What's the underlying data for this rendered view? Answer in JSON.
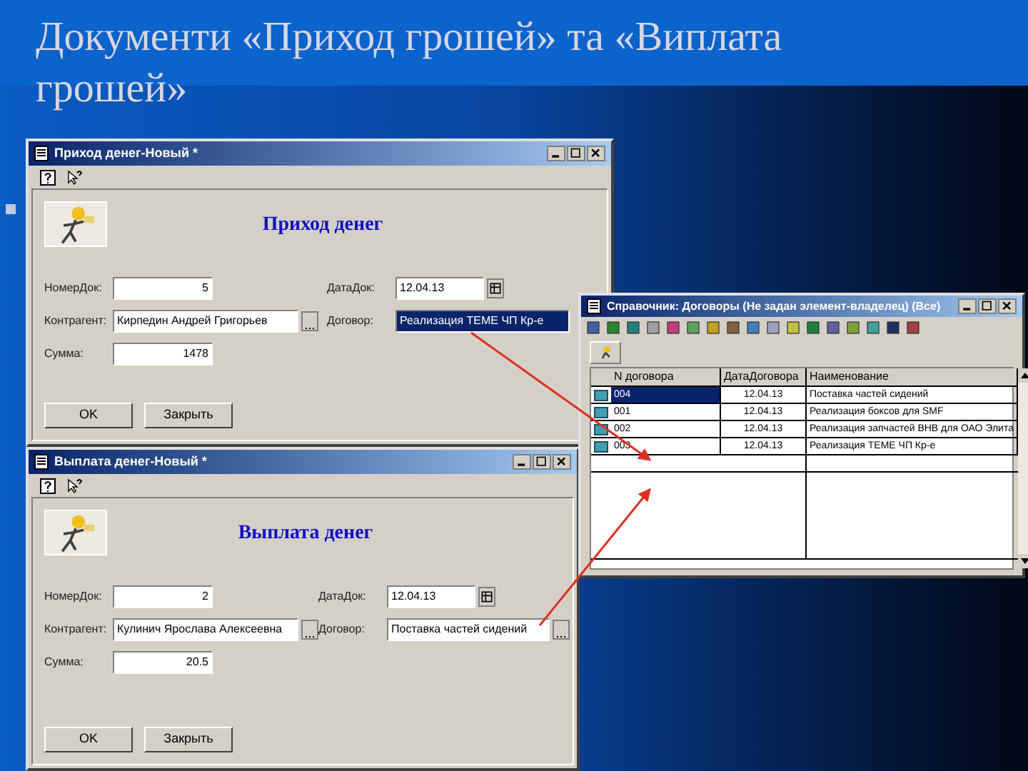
{
  "slide_title": "Документи «Приход грошей» та «Виплата грошей»",
  "windows": [
    {
      "title": "Приход денег-Новый *",
      "heading": "Приход денег",
      "left_fields": [
        {
          "label": "НомерДок:",
          "value": "5",
          "kind": "number"
        },
        {
          "label": "Контрагент:",
          "value": "Кирпедин Андрей Григорьев",
          "kind": "select"
        },
        {
          "label": "Сумма:",
          "value": "1478",
          "kind": "number"
        }
      ],
      "right_fields": [
        {
          "label": "ДатаДок:",
          "value": "12.04.13",
          "kind": "date",
          "highlighted": false
        },
        {
          "label": "Договор:",
          "value": "Реализация ТЕМЕ ЧП Кр-е",
          "kind": "text",
          "highlighted": true
        }
      ],
      "buttons": [
        "OK",
        "Закрыть"
      ]
    },
    {
      "title": "Выплата денег-Новый *",
      "heading": "Выплата денег",
      "left_fields": [
        {
          "label": "НомерДок:",
          "value": "2",
          "kind": "number"
        },
        {
          "label": "Контрагент:",
          "value": "Кулинич Ярослава Алексеевна",
          "kind": "select"
        },
        {
          "label": "Сумма:",
          "value": "20.5",
          "kind": "number"
        }
      ],
      "right_fields": [
        {
          "label": "ДатаДок:",
          "value": "12.04.13",
          "kind": "date",
          "highlighted": false
        },
        {
          "label": "Договор:",
          "value": "Поставка частей сидений",
          "kind": "select",
          "highlighted": false
        }
      ],
      "buttons": [
        "OK",
        "Закрыть"
      ]
    }
  ],
  "catalog": {
    "title": "Справочник: Договоры (Не задан элемент-владелец) (Все)",
    "columns": [
      "N договора",
      "ДатаДоговора",
      "Наименование"
    ],
    "rows": [
      {
        "cells": [
          "004",
          "12.04.13",
          "Поставка частей сидений"
        ],
        "selected": true
      },
      {
        "cells": [
          "001",
          "12.04.13",
          "Реализация боксов для SMF"
        ],
        "selected": false
      },
      {
        "cells": [
          "002",
          "12.04.13",
          "Реализация запчастей ВНВ для ОАО Элита"
        ],
        "selected": false
      },
      {
        "cells": [
          "003",
          "12.04.13",
          "Реализация ТЕМЕ ЧП Кр-е"
        ],
        "selected": false
      }
    ]
  }
}
